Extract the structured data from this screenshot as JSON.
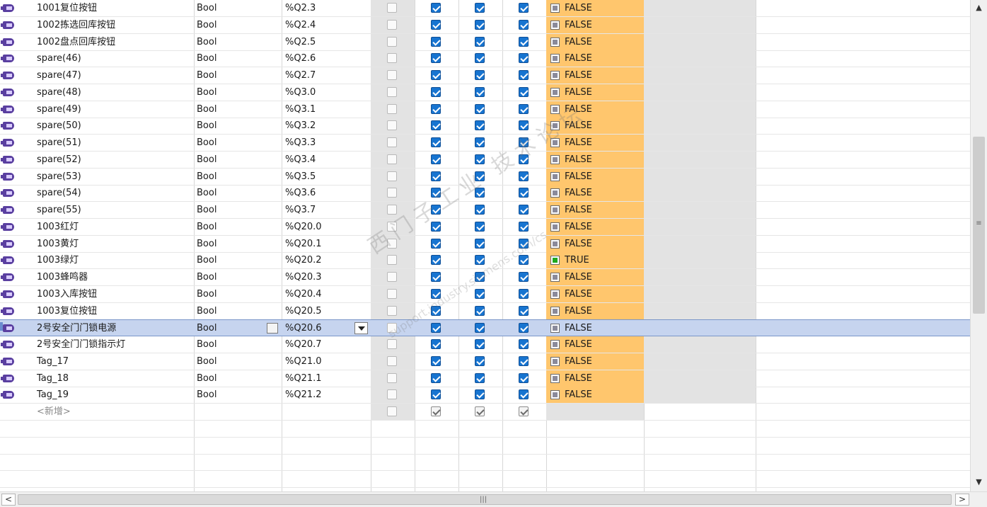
{
  "rows": [
    {
      "name": "1001复位按钮",
      "type": "Bool",
      "address": "%Q2.3",
      "visible": true,
      "accessible": true,
      "writable": true,
      "monitor": "FALSE"
    },
    {
      "name": "1002拣选回库按钮",
      "type": "Bool",
      "address": "%Q2.4",
      "visible": true,
      "accessible": true,
      "writable": true,
      "monitor": "FALSE"
    },
    {
      "name": "1002盘点回库按钮",
      "type": "Bool",
      "address": "%Q2.5",
      "visible": true,
      "accessible": true,
      "writable": true,
      "monitor": "FALSE"
    },
    {
      "name": "spare(46)",
      "type": "Bool",
      "address": "%Q2.6",
      "visible": true,
      "accessible": true,
      "writable": true,
      "monitor": "FALSE"
    },
    {
      "name": "spare(47)",
      "type": "Bool",
      "address": "%Q2.7",
      "visible": true,
      "accessible": true,
      "writable": true,
      "monitor": "FALSE"
    },
    {
      "name": "spare(48)",
      "type": "Bool",
      "address": "%Q3.0",
      "visible": true,
      "accessible": true,
      "writable": true,
      "monitor": "FALSE"
    },
    {
      "name": "spare(49)",
      "type": "Bool",
      "address": "%Q3.1",
      "visible": true,
      "accessible": true,
      "writable": true,
      "monitor": "FALSE"
    },
    {
      "name": "spare(50)",
      "type": "Bool",
      "address": "%Q3.2",
      "visible": true,
      "accessible": true,
      "writable": true,
      "monitor": "FALSE"
    },
    {
      "name": "spare(51)",
      "type": "Bool",
      "address": "%Q3.3",
      "visible": true,
      "accessible": true,
      "writable": true,
      "monitor": "FALSE"
    },
    {
      "name": "spare(52)",
      "type": "Bool",
      "address": "%Q3.4",
      "visible": true,
      "accessible": true,
      "writable": true,
      "monitor": "FALSE"
    },
    {
      "name": "spare(53)",
      "type": "Bool",
      "address": "%Q3.5",
      "visible": true,
      "accessible": true,
      "writable": true,
      "monitor": "FALSE"
    },
    {
      "name": "spare(54)",
      "type": "Bool",
      "address": "%Q3.6",
      "visible": true,
      "accessible": true,
      "writable": true,
      "monitor": "FALSE"
    },
    {
      "name": "spare(55)",
      "type": "Bool",
      "address": "%Q3.7",
      "visible": true,
      "accessible": true,
      "writable": true,
      "monitor": "FALSE"
    },
    {
      "name": "1003红灯",
      "type": "Bool",
      "address": "%Q20.0",
      "visible": true,
      "accessible": true,
      "writable": true,
      "monitor": "FALSE"
    },
    {
      "name": "1003黄灯",
      "type": "Bool",
      "address": "%Q20.1",
      "visible": true,
      "accessible": true,
      "writable": true,
      "monitor": "FALSE"
    },
    {
      "name": "1003绿灯",
      "type": "Bool",
      "address": "%Q20.2",
      "visible": true,
      "accessible": true,
      "writable": true,
      "monitor": "TRUE"
    },
    {
      "name": "1003蜂鸣器",
      "type": "Bool",
      "address": "%Q20.3",
      "visible": true,
      "accessible": true,
      "writable": true,
      "monitor": "FALSE"
    },
    {
      "name": "1003入库按钮",
      "type": "Bool",
      "address": "%Q20.4",
      "visible": true,
      "accessible": true,
      "writable": true,
      "monitor": "FALSE"
    },
    {
      "name": "1003复位按钮",
      "type": "Bool",
      "address": "%Q20.5",
      "visible": true,
      "accessible": true,
      "writable": true,
      "monitor": "FALSE"
    },
    {
      "name": "2号安全门门锁电源",
      "type": "Bool",
      "address": "%Q20.6",
      "visible": true,
      "accessible": true,
      "writable": true,
      "monitor": "FALSE",
      "selected": true
    },
    {
      "name": "2号安全门门锁指示灯",
      "type": "Bool",
      "address": "%Q20.7",
      "visible": true,
      "accessible": true,
      "writable": true,
      "monitor": "FALSE"
    },
    {
      "name": "Tag_17",
      "type": "Bool",
      "address": "%Q21.0",
      "visible": true,
      "accessible": true,
      "writable": true,
      "monitor": "FALSE"
    },
    {
      "name": "Tag_18",
      "type": "Bool",
      "address": "%Q21.1",
      "visible": true,
      "accessible": true,
      "writable": true,
      "monitor": "FALSE"
    },
    {
      "name": "Tag_19",
      "type": "Bool",
      "address": "%Q21.2",
      "visible": true,
      "accessible": true,
      "writable": true,
      "monitor": "FALSE"
    }
  ],
  "new_row": {
    "label": "<新增>"
  },
  "icons": {
    "tag": "plc-tag-output-icon",
    "ellipsis": "type-picker-icon",
    "dropdown": "chevron-down-icon",
    "scroll_up": "▲",
    "scroll_down": "▼",
    "scroll_left": "<",
    "scroll_right": ">",
    "v_grip": "≡",
    "h_grip": "|||"
  },
  "watermark": {
    "main": "西门子工业 技术论坛",
    "sub": "support.industry.siemens.com/cs"
  },
  "colors": {
    "monitor_bg": "#ffc66d",
    "checked": "#1774d0",
    "true_lamp": "#1fa81f",
    "selection": "#c6d4ef"
  }
}
